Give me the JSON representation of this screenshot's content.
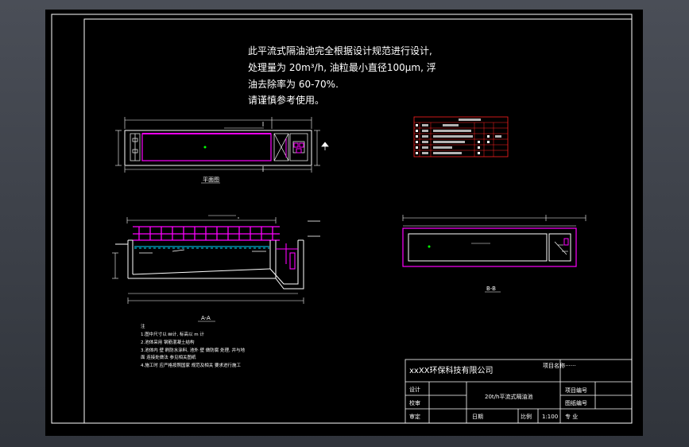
{
  "colors": {
    "background": "#000000",
    "line": "#ffffff",
    "magenta": "#ff00ff",
    "red": "#ff2020",
    "green": "#00ff00",
    "cyan": "#00d8ff",
    "dim": "#a0a0a0"
  },
  "notes_top": {
    "line1": "此平流式隔油池完全根据设计规范进行设计,",
    "line2": "处理量为 20m³/h, 油粒最小直径100μm, 浮",
    "line3": "油去除率为 60-70%.",
    "line4": "请谨慎参考使用。"
  },
  "views": {
    "plan_label": "平面图",
    "section_aa_label": "A-A",
    "section_bb_label": "B-B"
  },
  "notes_bottom": {
    "heading": "注",
    "l1": "1.图中尺寸以 ㎜计,  标高以 m 计",
    "l2": "2.池体采用 钢筋混凝土结构",
    "l3": "3.池体内 壁 刷防水涂料, 池外 壁 做防腐  处理, 并与地",
    "l4": "  面 连接处做法  参见相关图纸",
    "l5": "4.施工时  应严格按照国家 规范及相关 要求进行施工"
  },
  "title_block": {
    "company": "xxXX环保科技有限公司",
    "project_name_label": "项目名称",
    "project_name_value": "·······",
    "design_label": "设计",
    "check_label": "校审",
    "approve_label": "审定",
    "drawing_title": "20t/h平流式隔油池",
    "date_label": "日期",
    "scale_label": "比例",
    "scale_value": "1:100",
    "project_no_label": "项目编号",
    "drawing_no_label": "图纸编号",
    "specialty_label": "专  业"
  }
}
